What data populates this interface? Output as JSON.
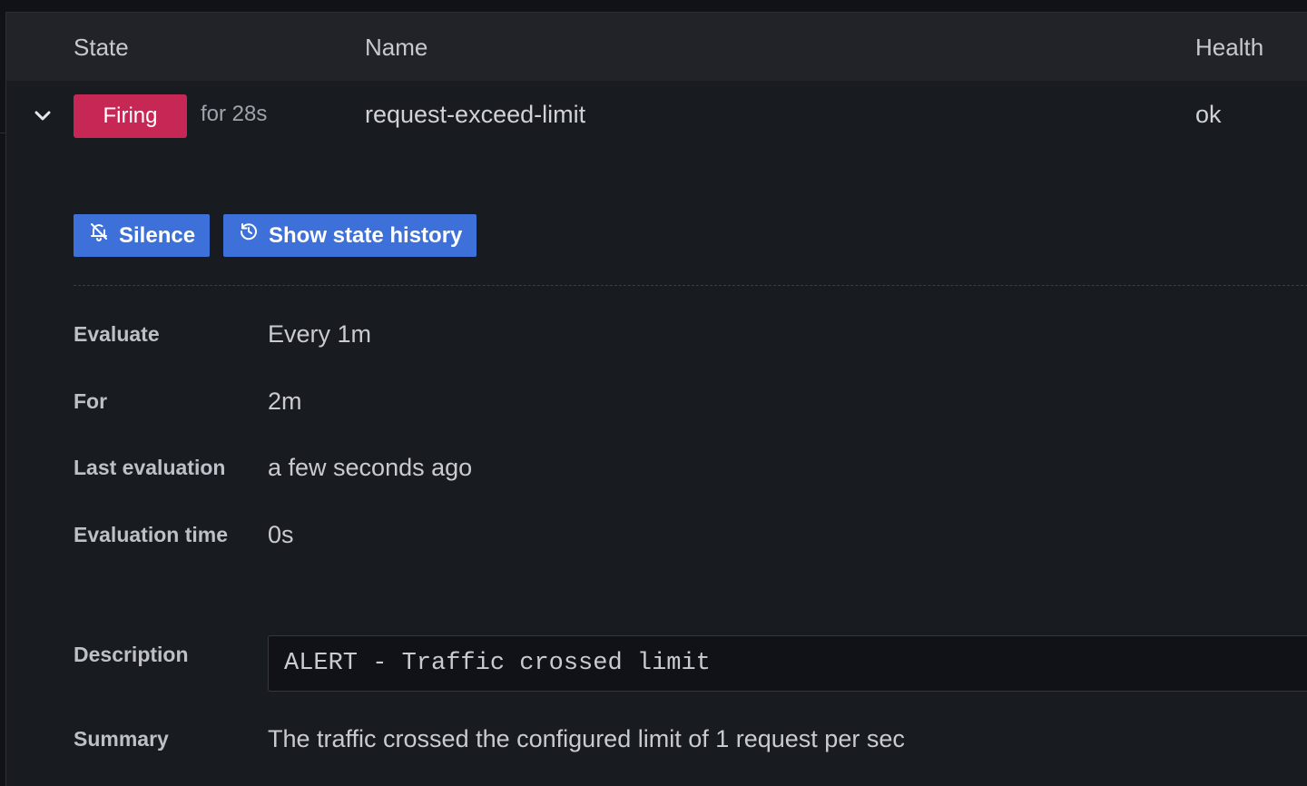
{
  "table": {
    "headers": {
      "state": "State",
      "name": "Name",
      "health": "Health"
    }
  },
  "rule": {
    "state": "Firing",
    "state_color": "#c72755",
    "duration": "for 28s",
    "name": "request-exceed-limit",
    "health": "ok"
  },
  "actions": {
    "silence_label": "Silence",
    "history_label": "Show state history",
    "button_color": "#3d71d9"
  },
  "details": {
    "evaluate_label": "Evaluate",
    "evaluate_value": "Every 1m",
    "for_label": "For",
    "for_value": "2m",
    "last_eval_label": "Last evaluation",
    "last_eval_value": "a few seconds ago",
    "eval_time_label": "Evaluation time",
    "eval_time_value": "0s",
    "description_label": "Description",
    "description_value": "ALERT - Traffic crossed limit",
    "summary_label": "Summary",
    "summary_value": "The traffic crossed the configured limit of 1 request per sec"
  },
  "icons": {
    "chevron": "chevron-down-icon",
    "silence": "bell-slash-icon",
    "history": "history-icon"
  }
}
